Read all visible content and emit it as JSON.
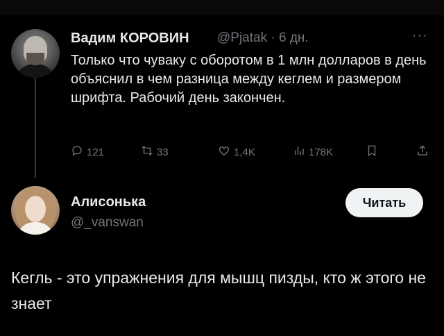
{
  "tweet": {
    "author_name": "Вадим КОРОВИН",
    "author_handle": "@Pjatak · 6 дн.",
    "more_icon": "more-dots-icon",
    "text": "Только что чуваку с оборотом в 1 млн долларов в день объяснил в чем разница между кеглем и размером шрифта.  Рабочий день закончен.",
    "actions": {
      "replies": "121",
      "retweets": "33",
      "likes": "1,4K",
      "views": "178K"
    }
  },
  "reply": {
    "author_name": "Алисонька",
    "author_handle": "@_vanswan",
    "follow_label": "Читать",
    "text": "Кегль - это упражнения для мышц пизды, кто ж этого не знает"
  },
  "colors": {
    "background": "#000000",
    "text": "#e7e9ea",
    "muted": "#71767b",
    "button_bg": "#eff3f4"
  }
}
